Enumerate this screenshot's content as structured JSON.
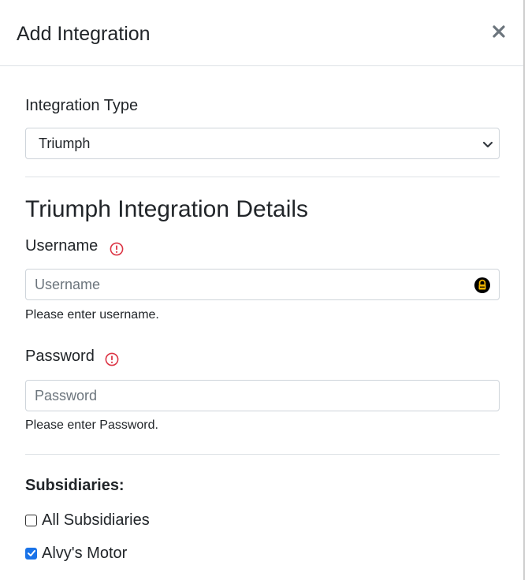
{
  "modal": {
    "title": "Add Integration",
    "close_icon": "close-icon"
  },
  "integration_type": {
    "label": "Integration Type",
    "selected": "Triumph"
  },
  "details": {
    "title": "Triumph Integration Details",
    "username": {
      "label": "Username",
      "placeholder": "Username",
      "help": "Please enter username.",
      "required_icon": "exclamation-circle-icon",
      "addon_icon": "password-manager-lock-icon"
    },
    "password": {
      "label": "Password",
      "placeholder": "Password",
      "help": "Please enter Password.",
      "required_icon": "exclamation-circle-icon"
    }
  },
  "subsidiaries": {
    "title": "Subsidiaries:",
    "items": [
      {
        "label": "All Subsidiaries",
        "checked": false
      },
      {
        "label": "Alvy's Motor",
        "checked": true
      }
    ]
  },
  "colors": {
    "required": "#dc3545",
    "checkbox_checked": "#1a73e8",
    "lock_icon": "#f0b400"
  }
}
